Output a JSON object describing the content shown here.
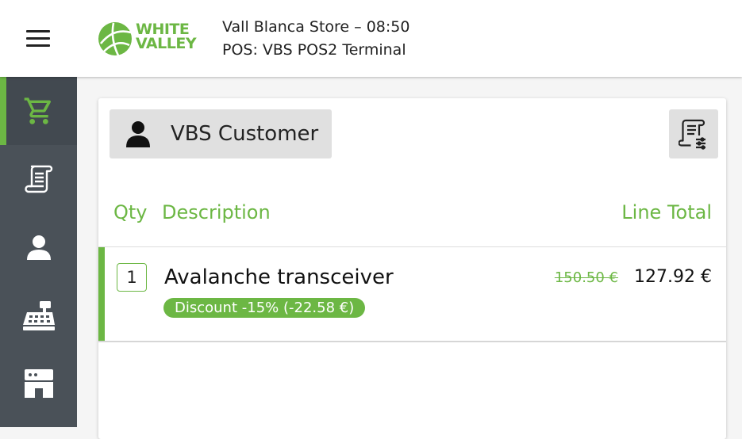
{
  "header": {
    "logo_line1": "WHITE",
    "logo_line2": "VALLEY",
    "store_line": "Vall Blanca Store – 08:50",
    "terminal_line": "POS: VBS POS2 Terminal"
  },
  "sidebar": {
    "items": [
      {
        "icon": "cart-icon",
        "active": true
      },
      {
        "icon": "receipt-icon",
        "active": false
      },
      {
        "icon": "user-icon",
        "active": false
      },
      {
        "icon": "cash-register-icon",
        "active": false
      },
      {
        "icon": "store-icon",
        "active": false
      }
    ]
  },
  "ticket": {
    "customer_label": "VBS Customer",
    "columns": {
      "qty": "Qty",
      "description": "Description",
      "line_total": "Line Total"
    },
    "lines": [
      {
        "qty": "1",
        "description": "Avalanche transceiver",
        "discount": "Discount -15% (-22.58 €)",
        "original_price": "150.50 €",
        "price": "127.92 €"
      }
    ]
  },
  "colors": {
    "accent": "#6cb744",
    "sidebar": "#4a5158",
    "button": "#e0e0e0"
  }
}
